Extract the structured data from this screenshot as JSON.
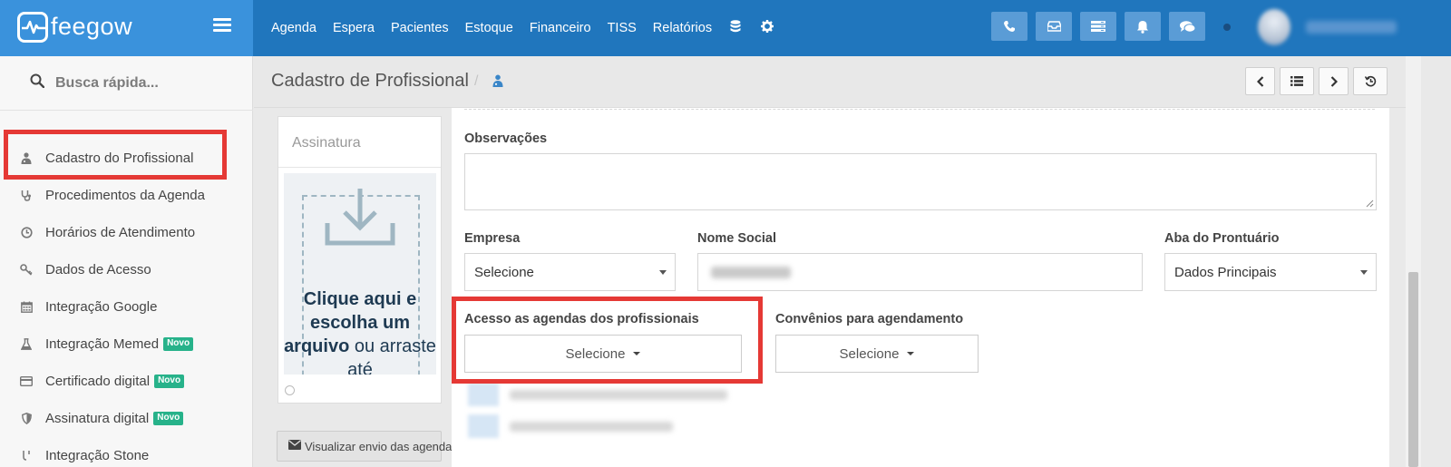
{
  "app": {
    "logo_text": "feegow"
  },
  "topnav": {
    "items": [
      "Agenda",
      "Espera",
      "Pacientes",
      "Estoque",
      "Financeiro",
      "TISS",
      "Relatórios"
    ],
    "extra_icons": [
      "database-icon",
      "gear-icon"
    ],
    "action_icons": [
      "phone-icon",
      "inbox-icon",
      "list-card-icon",
      "bell-icon",
      "chat-icon"
    ]
  },
  "sidebar": {
    "search_label": "Busca rápida...",
    "items": [
      {
        "label": "Cadastro do Profissional",
        "icon": "doctor-icon",
        "badge": ""
      },
      {
        "label": "Procedimentos da Agenda",
        "icon": "stethoscope-icon",
        "badge": ""
      },
      {
        "label": "Horários de Atendimento",
        "icon": "clock-icon",
        "badge": ""
      },
      {
        "label": "Dados de Acesso",
        "icon": "key-icon",
        "badge": ""
      },
      {
        "label": "Integração Google",
        "icon": "calendar-icon",
        "badge": ""
      },
      {
        "label": "Integração Memed",
        "icon": "flask-icon",
        "badge": "Novo"
      },
      {
        "label": "Certificado digital",
        "icon": "credit-card-icon",
        "badge": "Novo"
      },
      {
        "label": "Assinatura digital",
        "icon": "shield-icon",
        "badge": "Novo"
      },
      {
        "label": "Integração Stone",
        "icon": "stone-icon",
        "badge": ""
      }
    ]
  },
  "header": {
    "title": "Cadastro de Profissional",
    "separator": "/"
  },
  "signature": {
    "title": "Assinatura",
    "drop_text_bold_1": "Clique aqui e escolha um arquivo",
    "drop_text_rest": " ou arraste até"
  },
  "send_button_label": "Visualizar envio das agendas",
  "form": {
    "observacoes_label": "Observações",
    "empresa_label": "Empresa",
    "empresa_value": "Selecione",
    "nome_social_label": "Nome Social",
    "aba_label": "Aba do Prontuário",
    "aba_value": "Dados Principais",
    "acesso_label": "Acesso as agendas dos profissionais",
    "acesso_value": "Selecione",
    "convenios_label": "Convênios para agendamento",
    "convenios_value": "Selecione"
  },
  "colors": {
    "topbar": "#2076bd",
    "brand": "#3a92dc",
    "highlight": "#e53935",
    "badge": "#27b28a"
  }
}
